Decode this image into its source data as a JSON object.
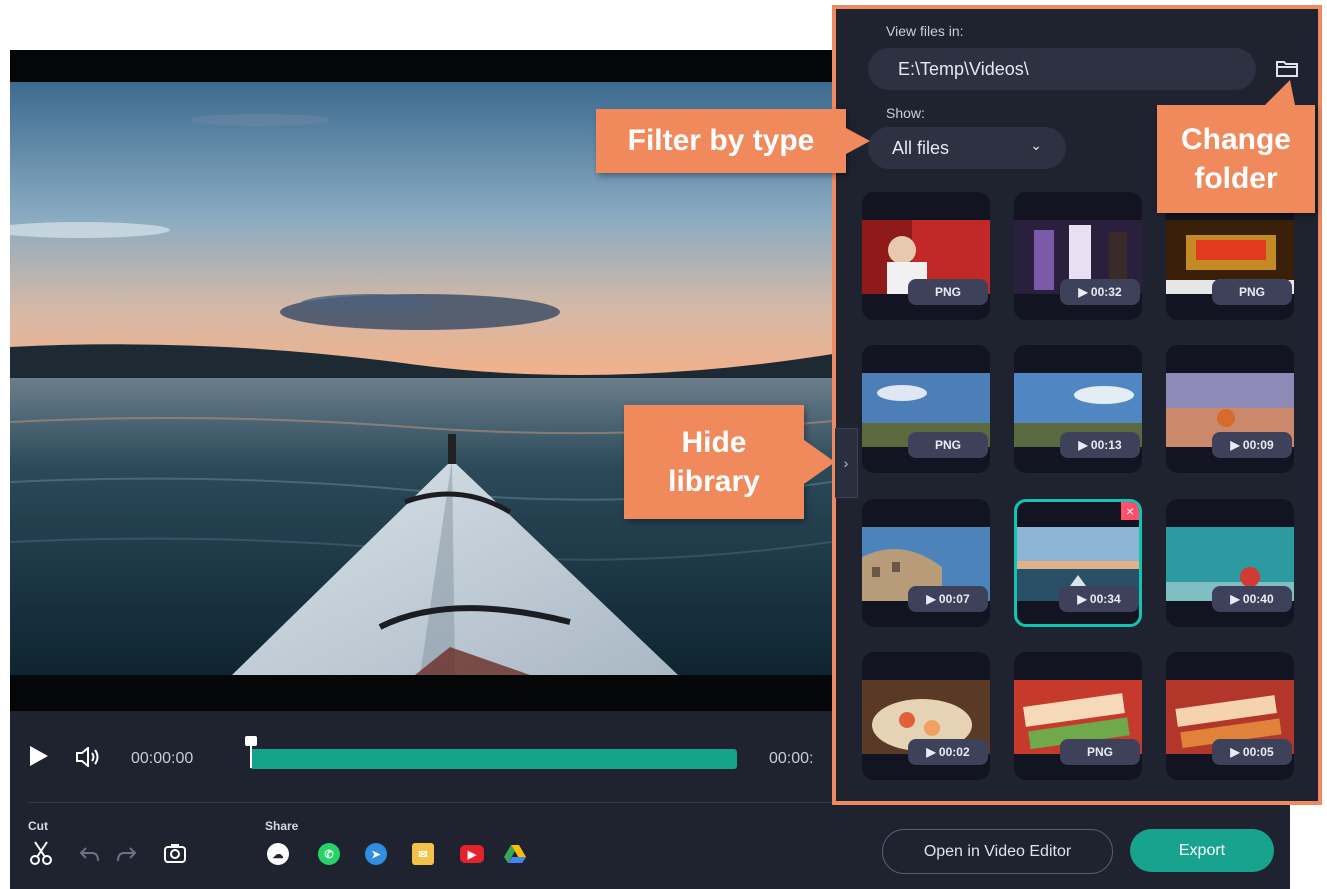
{
  "player": {
    "current_time": "00:00:00",
    "end_time": "00:00:",
    "cut_label": "Cut",
    "share_label": "Share",
    "open_editor_label": "Open in Video Editor",
    "export_label": "Export",
    "progress_fraction": 0.0
  },
  "library": {
    "view_files_label": "View files in:",
    "path_value": "E:\\Temp\\Videos\\",
    "show_label": "Show:",
    "filter_value": "All files",
    "items": [
      {
        "badge": "PNG"
      },
      {
        "badge": "▶ 00:32"
      },
      {
        "badge": "PNG"
      },
      {
        "badge": "PNG"
      },
      {
        "badge": "▶ 00:13"
      },
      {
        "badge": "▶ 00:09"
      },
      {
        "badge": "▶ 00:07"
      },
      {
        "badge": "▶ 00:34",
        "selected": true
      },
      {
        "badge": "▶ 00:40"
      },
      {
        "badge": "▶ 00:02"
      },
      {
        "badge": "PNG"
      },
      {
        "badge": "▶ 00:05"
      }
    ]
  },
  "callouts": {
    "filter_by_type": "Filter by type",
    "change_folder_line1": "Change",
    "change_folder_line2": "folder",
    "hide_library_line1": "Hide",
    "hide_library_line2": "library"
  },
  "icons": {
    "play": "play-icon",
    "volume": "volume-icon",
    "cut": "scissors-icon",
    "undo": "undo-icon",
    "redo": "redo-icon",
    "snapshot": "camera-icon",
    "folder": "folder-icon"
  },
  "colors": {
    "accent": "#17a38d",
    "callout": "#f08a5d",
    "panel_border": "#ef8a5f"
  }
}
